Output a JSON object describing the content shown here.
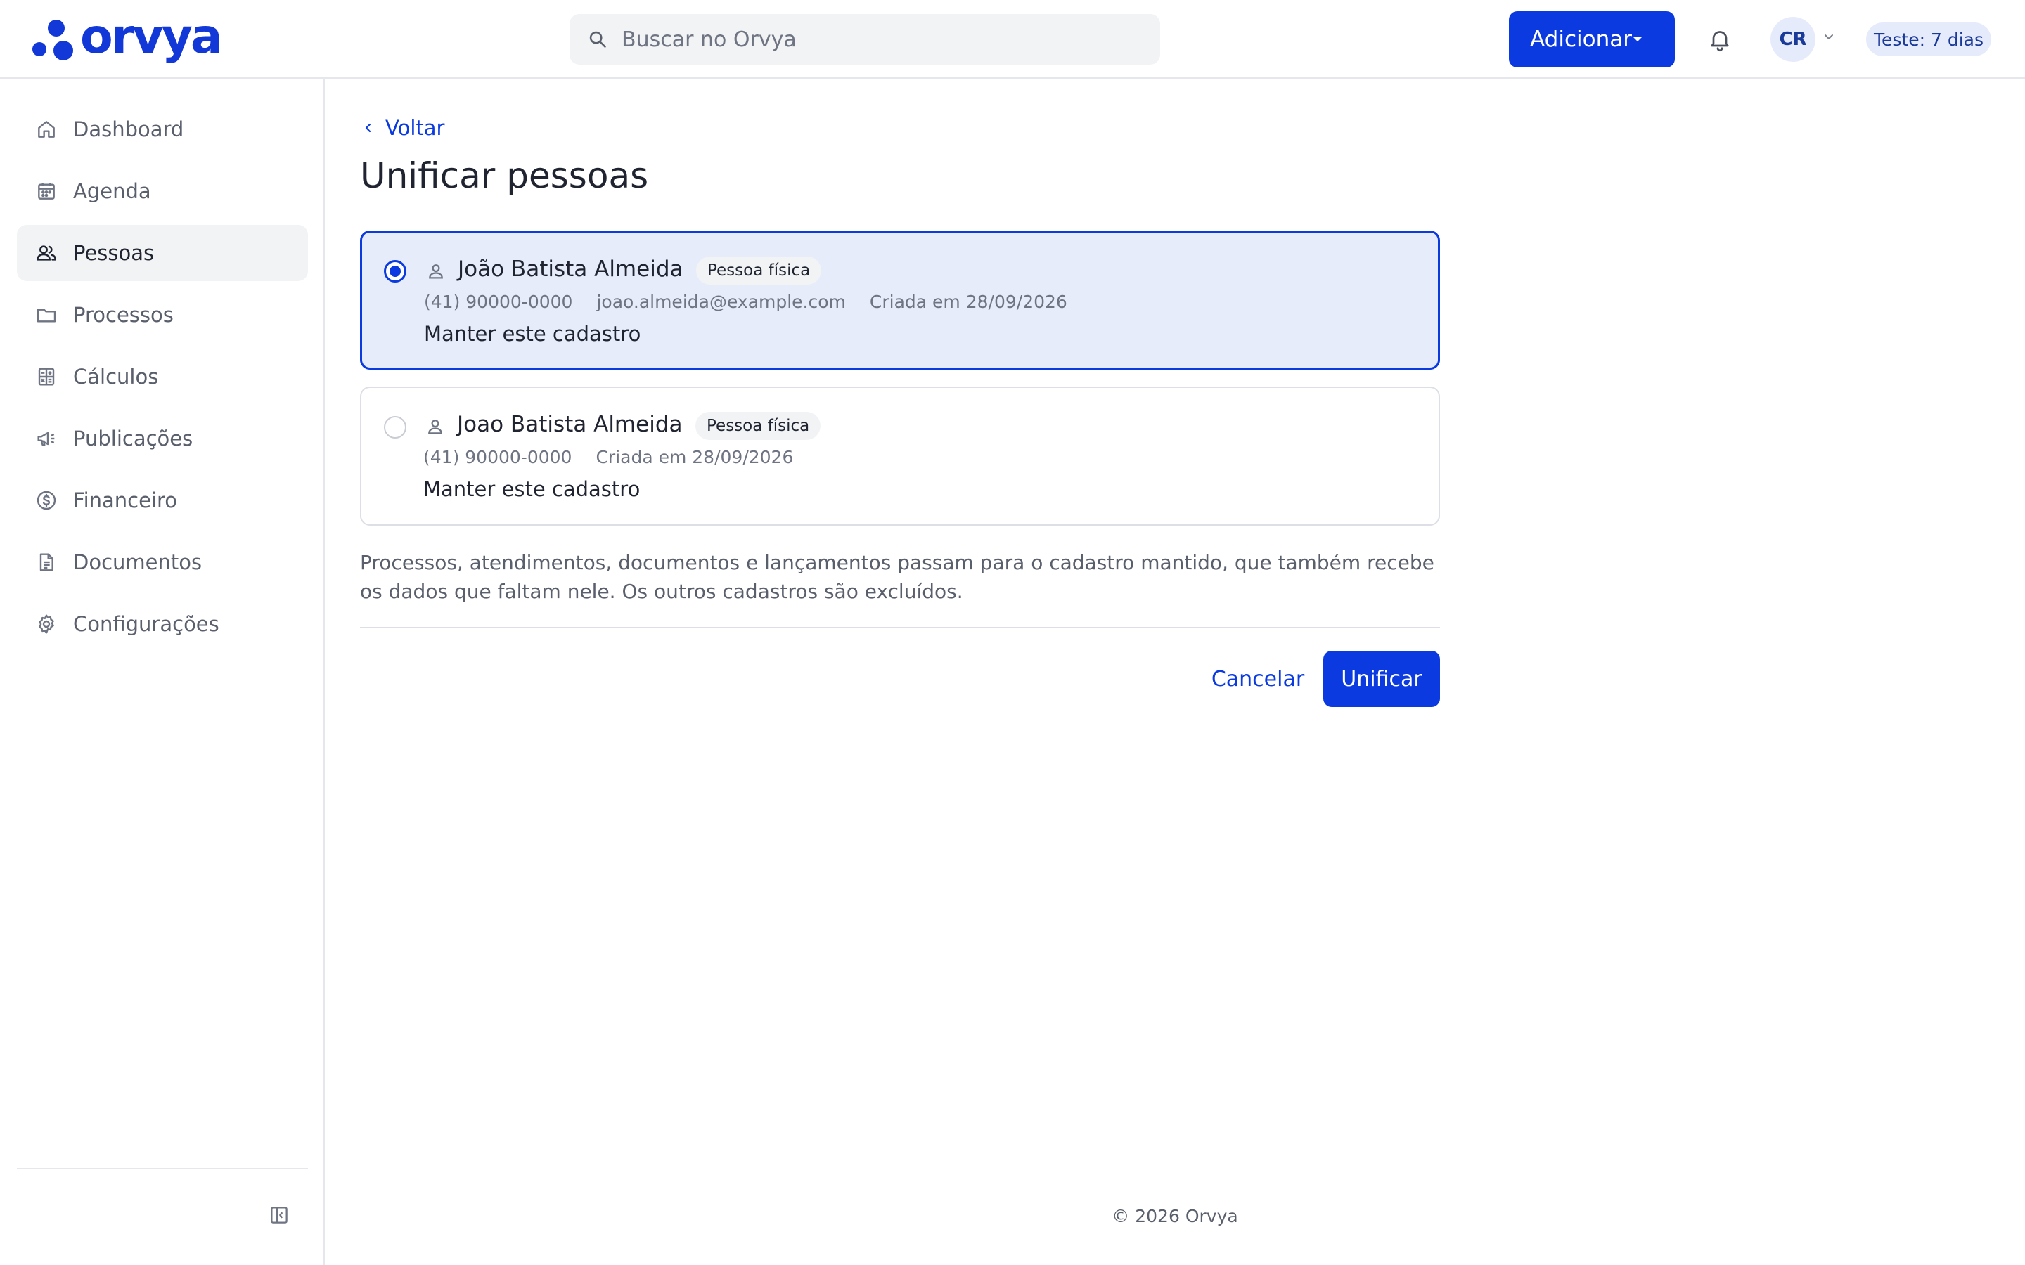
{
  "brand": {
    "name": "orvya",
    "color": "#1238d8"
  },
  "search": {
    "placeholder": "Buscar no Orvya",
    "value": ""
  },
  "header": {
    "add_label": "Adicionar",
    "avatar_initials": "CR",
    "trial_label": "Teste: 7 dias",
    "icons": [
      "search-icon",
      "bell-icon",
      "chevron-down-icon"
    ]
  },
  "sidebar": {
    "items": [
      {
        "label": "Dashboard",
        "icon": "home-icon",
        "active": false
      },
      {
        "label": "Agenda",
        "icon": "calendar-icon",
        "active": false
      },
      {
        "label": "Pessoas",
        "icon": "people-icon",
        "active": true
      },
      {
        "label": "Processos",
        "icon": "folder-icon",
        "active": false
      },
      {
        "label": "Cálculos",
        "icon": "calculator-icon",
        "active": false
      },
      {
        "label": "Publicações",
        "icon": "megaphone-icon",
        "active": false
      },
      {
        "label": "Financeiro",
        "icon": "dollar-icon",
        "active": false
      },
      {
        "label": "Documentos",
        "icon": "document-icon",
        "active": false
      },
      {
        "label": "Configurações",
        "icon": "gear-icon",
        "active": false
      }
    ],
    "collapse_icon": "sidebar-collapse-icon"
  },
  "main": {
    "back_label": "Voltar",
    "title": "Unificar pessoas",
    "records": [
      {
        "selected": true,
        "name": "João Batista Almeida",
        "type": "Pessoa física",
        "phone": "(41) 90000-0000",
        "email": "joao.almeida@example.com",
        "created": "Criada em 28/09/2026",
        "keep_label": "Manter este cadastro"
      },
      {
        "selected": false,
        "name": "Joao Batista Almeida",
        "type": "Pessoa física",
        "phone": "(41) 90000-0000",
        "created": "Criada em 28/09/2026",
        "keep_label": "Manter este cadastro"
      }
    ],
    "notice": "Processos, atendimentos, documentos e lançamentos passam para o cadastro mantido, que também recebe os dados que faltam nele. Os outros cadastros são excluídos.",
    "cancel_label": "Cancelar",
    "unify_label": "Unificar"
  },
  "footer": {
    "text": "© 2026 Orvya"
  },
  "colors": {
    "primary": "#0b3be0",
    "selected_bg": "#e7ecfb",
    "muted_bg": "#f2f3f5"
  }
}
